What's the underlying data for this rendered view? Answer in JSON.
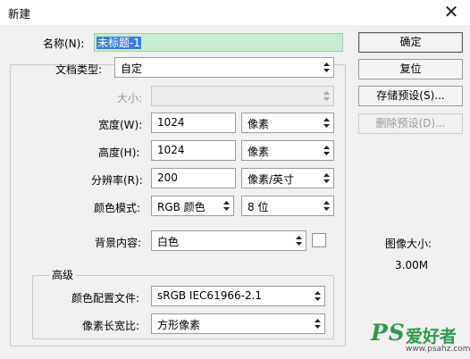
{
  "window": {
    "title": "新建",
    "close_glyph": "✕"
  },
  "name": {
    "label": "名称(N):",
    "value": "未标题-1"
  },
  "preset": {
    "label": "文档类型:",
    "value": "自定"
  },
  "size": {
    "label": "大小:",
    "value": ""
  },
  "width": {
    "label": "宽度(W):",
    "value": "1024",
    "unit": "像素"
  },
  "height": {
    "label": "高度(H):",
    "value": "1024",
    "unit": "像素"
  },
  "resolution": {
    "label": "分辨率(R):",
    "value": "200",
    "unit": "像素/英寸"
  },
  "color_mode": {
    "label": "颜色模式:",
    "value": "RGB 颜色",
    "bits": "8 位"
  },
  "background": {
    "label": "背景内容:",
    "value": "白色",
    "swatch_color": "#ffffff"
  },
  "advanced": {
    "legend": "高级",
    "profile": {
      "label": "颜色配置文件:",
      "value": "sRGB IEC61966-2.1"
    },
    "pixel_aspect": {
      "label": "像素长宽比:",
      "value": "方形像素"
    }
  },
  "buttons": {
    "ok": "确定",
    "reset": "复位",
    "save_preset": "存储预设(S)...",
    "delete_preset": "删除预设(D)..."
  },
  "image_size": {
    "label": "图像大小:",
    "value": "3.00M"
  },
  "watermark": {
    "logo": "PS",
    "text": "爱好者",
    "url": "www.psahz.com"
  }
}
